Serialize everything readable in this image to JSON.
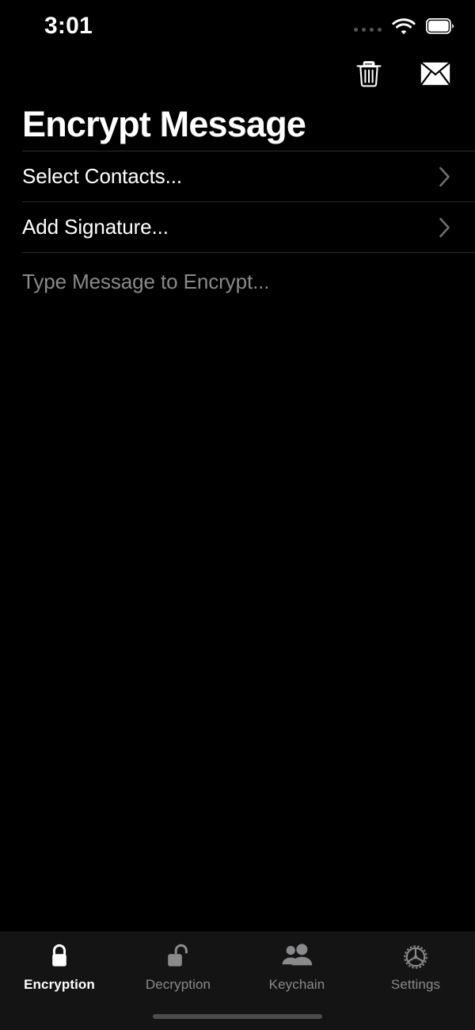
{
  "status_bar": {
    "time": "3:01",
    "cellular_icon": "signal-dots-icon",
    "wifi_icon": "wifi-icon",
    "battery_icon": "battery-full-icon"
  },
  "nav_actions": [
    {
      "name": "trash-button",
      "icon": "trash-icon",
      "label": "Delete"
    },
    {
      "name": "mail-button",
      "icon": "envelope-icon",
      "label": "Mail"
    }
  ],
  "header": {
    "title": "Encrypt Message"
  },
  "form": {
    "rows": [
      {
        "label": "Select Contacts...",
        "accessory": "chevron-right-icon"
      },
      {
        "label": "Add Signature...",
        "accessory": "chevron-right-icon"
      }
    ],
    "message_editor": {
      "placeholder": "Type Message to Encrypt...",
      "value": ""
    }
  },
  "tab_bar": {
    "active_index": 0,
    "tabs": [
      {
        "label": "Encryption",
        "icon": "lock-closed-icon",
        "active": true
      },
      {
        "label": "Decryption",
        "icon": "lock-open-icon",
        "active": false
      },
      {
        "label": "Keychain",
        "icon": "people-icon",
        "active": false
      },
      {
        "label": "Settings",
        "icon": "gear-icon",
        "active": false
      }
    ],
    "home_indicator": "home-indicator"
  },
  "colors": {
    "background": "#000000",
    "tab_bar_background": "#141414",
    "separator": "#2b2b2b",
    "primary_text": "#ffffff",
    "secondary_text": "#8a8a8d",
    "home_indicator": "#4c4c4e"
  }
}
